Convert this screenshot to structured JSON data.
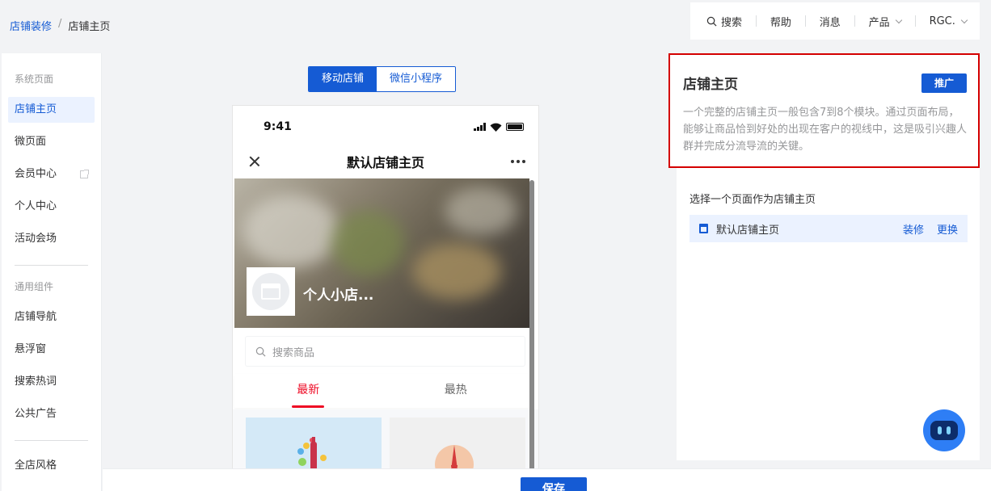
{
  "breadcrumb": {
    "parent": "店铺装修",
    "separator": "/",
    "current": "店铺主页"
  },
  "topnav": {
    "search": "搜索",
    "help": "帮助",
    "messages": "消息",
    "products": "产品",
    "account": "RGC."
  },
  "sidebar": {
    "section1_title": "系统页面",
    "section1_items": [
      "店铺主页",
      "微页面",
      "会员中心",
      "个人中心",
      "活动会场"
    ],
    "section2_title": "通用组件",
    "section2_items": [
      "店铺导航",
      "悬浮窗",
      "搜索热词",
      "公共广告"
    ],
    "section3_items": [
      "全店风格"
    ]
  },
  "canvas": {
    "segment_active": "移动店铺",
    "segment_inactive": "微信小程序",
    "phone": {
      "time": "9:41",
      "nav_title": "默认店铺主页",
      "shop_name": "个人小店...",
      "search_placeholder": "搜索商品",
      "tab_latest": "最新",
      "tab_hot": "最热"
    }
  },
  "panel": {
    "title": "店铺主页",
    "promote_label": "推广",
    "description": "一个完整的店铺主页一般包含7到8个模块。通过页面布局，能够让商品恰到好处的出现在客户的视线中，这是吸引兴趣人群并完成分流导流的关键。",
    "choose_label": "选择一个页面作为店铺主页",
    "page_name": "默认店铺主页",
    "action_edit": "装修",
    "action_change": "更换"
  },
  "footer": {
    "save_label": "保存"
  },
  "colors": {
    "accent": "#155bd4",
    "highlight_border": "#d40000",
    "tab_active": "#ee0a24"
  }
}
